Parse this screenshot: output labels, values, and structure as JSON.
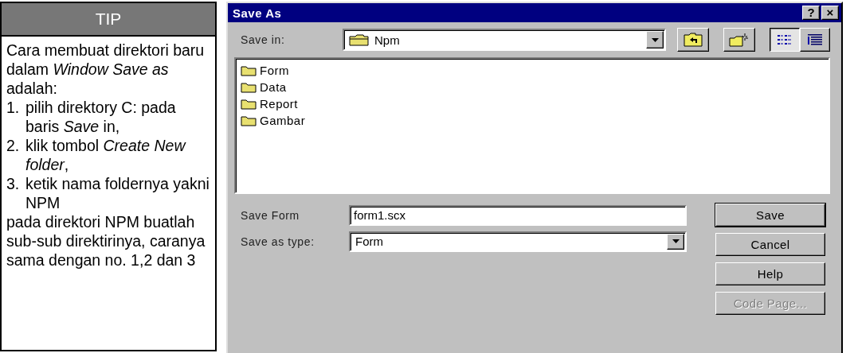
{
  "tip": {
    "title": "TIP",
    "intro": "Cara membuat direktori baru dalam *Window Save as* adalah:",
    "steps": [
      {
        "number": "1.",
        "text": "pilih direktory C: pada baris *Save* in,"
      },
      {
        "number": "2.",
        "text": "klik tombol *Create New folder*,"
      },
      {
        "number": "3.",
        "text": "ketik nama foldernya yakni NPM"
      }
    ],
    "outro": "pada direktori NPM buatlah sub-sub direktirinya, caranya sama dengan no. 1,2 dan 3"
  },
  "window": {
    "title": "Save As",
    "title_buttons": [
      "?",
      "×"
    ]
  },
  "save_in": {
    "label": "Save in:",
    "value": "Npm"
  },
  "view_buttons": [
    {
      "kind": "list",
      "selected": true
    },
    {
      "kind": "details",
      "selected": false
    }
  ],
  "files": [
    {
      "name": "Form"
    },
    {
      "name": "Data"
    },
    {
      "name": "Report"
    },
    {
      "name": "Gambar"
    }
  ],
  "file_name": {
    "label": "Save Form",
    "value": "form1.scx"
  },
  "file_type": {
    "label": "Save as type:",
    "value": "Form"
  },
  "buttons": [
    {
      "label": "Save",
      "default": true,
      "disabled": false
    },
    {
      "label": "Cancel",
      "default": false,
      "disabled": false
    },
    {
      "label": "Help",
      "default": false,
      "disabled": false
    },
    {
      "label": "Code Page...",
      "default": false,
      "disabled": true
    }
  ]
}
